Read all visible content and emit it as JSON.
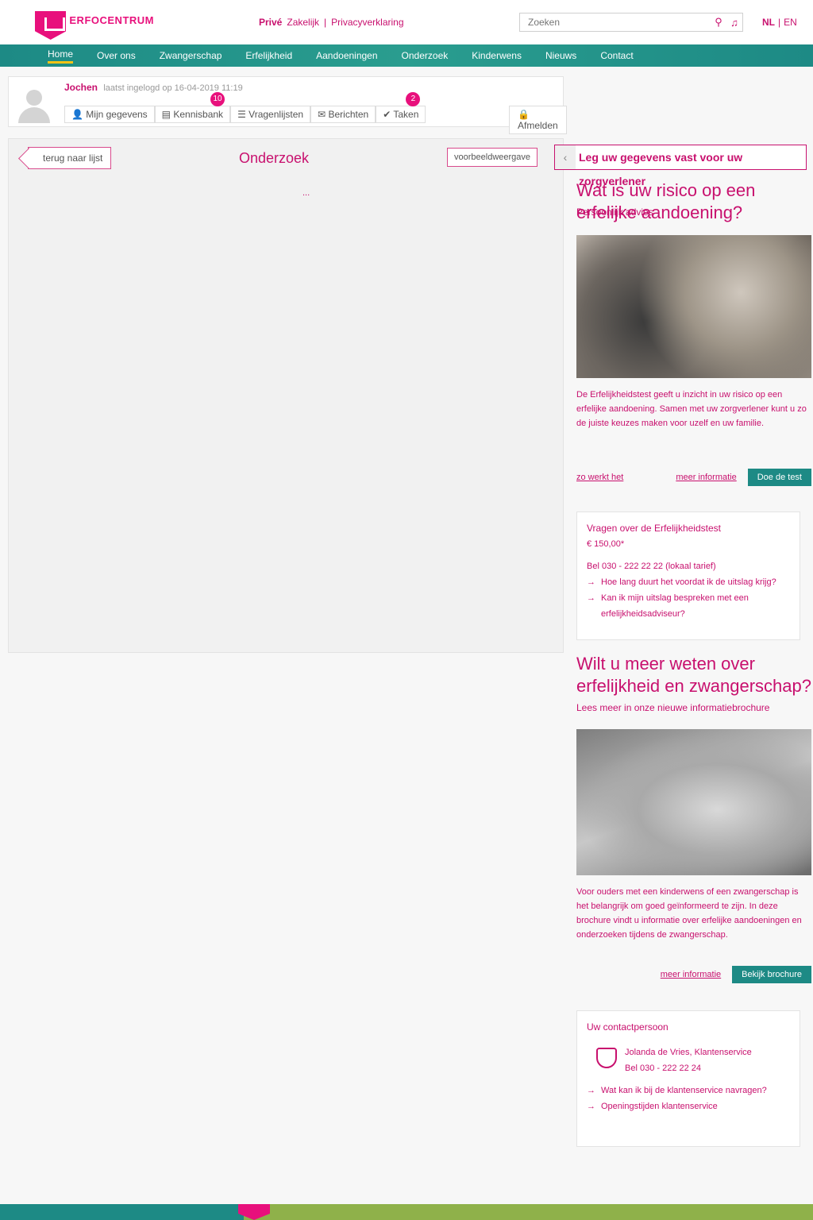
{
  "header": {
    "logo_text": "ERFOCENTRUM",
    "top_links": {
      "first": "Privé",
      "second": "Zakelijk",
      "separator": "|",
      "third": "Privacyverklaring"
    },
    "search": {
      "placeholder": "Zoeken",
      "search_icon": "search-icon",
      "mic_icon": "microphone-icon"
    },
    "lang": {
      "nl": "NL",
      "sep": "|",
      "en": "EN"
    }
  },
  "nav": {
    "items": [
      {
        "label": "Home"
      },
      {
        "label": "Over ons"
      },
      {
        "label": "Zwangerschap"
      },
      {
        "label": "Erfelijkheid"
      },
      {
        "label": "Aandoeningen"
      },
      {
        "label": "Onderzoek"
      },
      {
        "label": "Kinderwens"
      },
      {
        "label": "Nieuws"
      },
      {
        "label": "Contact"
      }
    ]
  },
  "user": {
    "name": "Jochen",
    "last_login": "laatst ingelogd op 16-04-2019 11:19",
    "tabs": [
      {
        "label": "Mijn gegevens",
        "icon": "user-icon"
      },
      {
        "label": "Kennisbank",
        "icon": "book-icon",
        "badge": "10"
      },
      {
        "label": "Vragenlijsten",
        "icon": "list-icon"
      },
      {
        "label": "Berichten",
        "icon": "mail-icon"
      },
      {
        "label": "Taken",
        "icon": "check-icon",
        "badge": "2"
      }
    ],
    "logout": "Afmelden",
    "logout_icon": "lock-icon"
  },
  "main": {
    "back": "terug naar lijst",
    "title": "Onderzoek",
    "preview": "voorbeeldweergave",
    "loading": "..."
  },
  "sidebar": {
    "cta": "Leg uw gegevens vast voor uw zorgverlener",
    "promo1": {
      "title": "Wat is uw risico op een erfelijke aandoening?",
      "subtitle": "Persoonlijk advies",
      "text": "De Erfelijkheidstest geeft u inzicht in uw risico op een erfelijke aandoening. Samen met uw zorgverlener kunt u zo de juiste keuzes maken voor uzelf en uw familie.",
      "link1": "zo werkt het",
      "link2": "meer informatie",
      "button": "Doe de test"
    },
    "info": {
      "head": "Vragen over de Erfelijkheidstest",
      "price": "€ 150,00*",
      "phone": "Bel 030 - 222 22 22 (lokaal tarief)",
      "link1": "Hoe lang duurt het voordat ik de uitslag krijg?",
      "link2": "Kan ik mijn uitslag bespreken met een erfelijkheidsadviseur?"
    },
    "promo2": {
      "title": "Wilt u meer weten over erfelijkheid en zwangerschap?",
      "subtitle": "Lees meer in onze nieuwe informatiebrochure",
      "text": "Voor ouders met een kinderwens of een zwangerschap is het belangrijk om goed geïnformeerd te zijn. In deze brochure vindt u informatie over erfelijke aandoeningen en onderzoeken tijdens de zwangerschap.",
      "link": "meer informatie",
      "button": "Bekijk brochure"
    },
    "contact": {
      "head": "Uw contactpersoon",
      "name": "Jolanda de Vries, Klantenservice",
      "phone": "Bel 030 - 222 22 24",
      "link1": "Wat kan ik bij de klantenservice navragen?",
      "link2": "Openingstijden klantenservice"
    }
  }
}
